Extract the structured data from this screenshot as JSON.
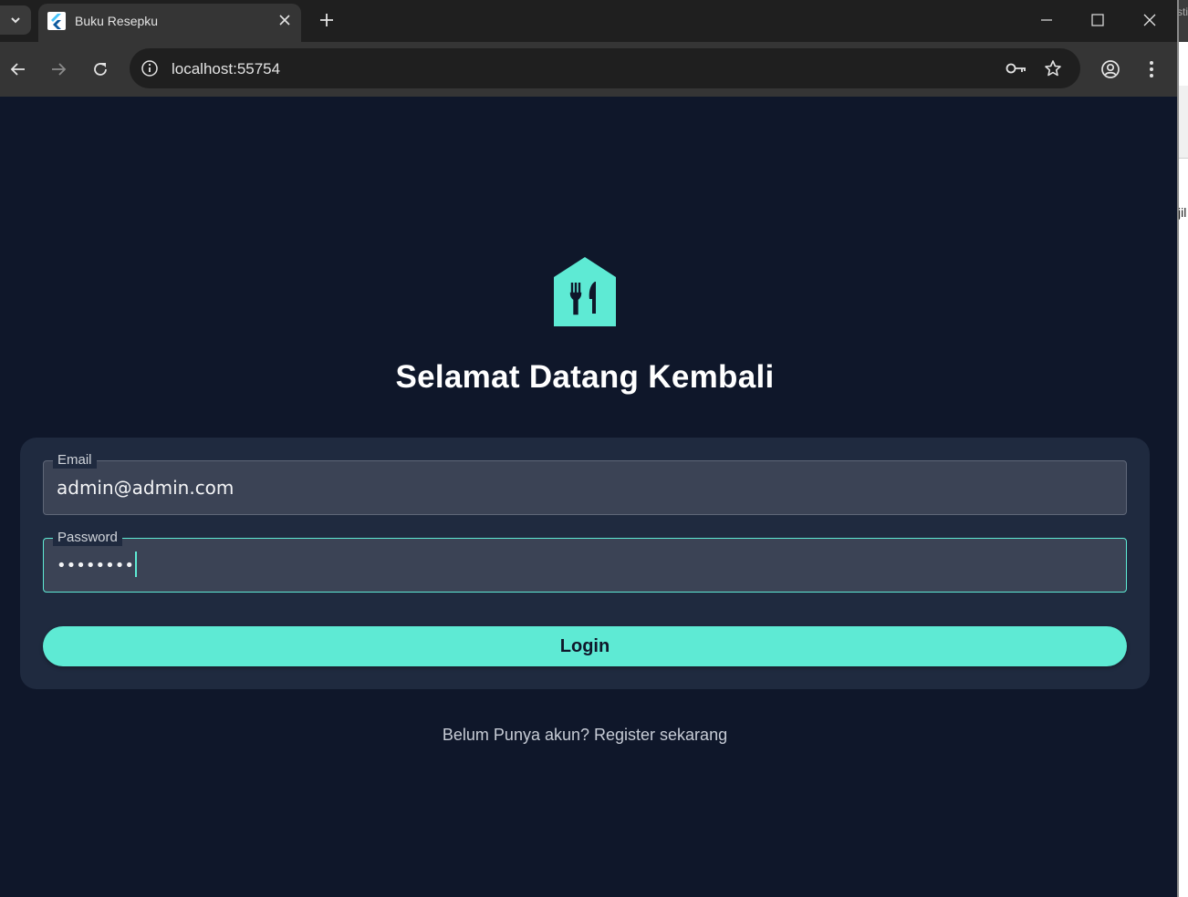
{
  "browser": {
    "tab": {
      "title": "Buku Resepku"
    },
    "address": {
      "url": "localhost:55754"
    }
  },
  "side_window": {
    "text_top": "sti",
    "text_mid": "jil"
  },
  "app": {
    "heading": "Selamat Datang Kembali",
    "email": {
      "label": "Email",
      "value": "admin@admin.com"
    },
    "password": {
      "label": "Password",
      "value": "••••••••"
    },
    "login_label": "Login",
    "register_text": "Belum Punya akun? Register sekarang"
  },
  "colors": {
    "page_bg": "#0f172a",
    "card_bg": "#1f2a3f",
    "accent": "#5eead4",
    "field_bg": "#3b4355"
  }
}
